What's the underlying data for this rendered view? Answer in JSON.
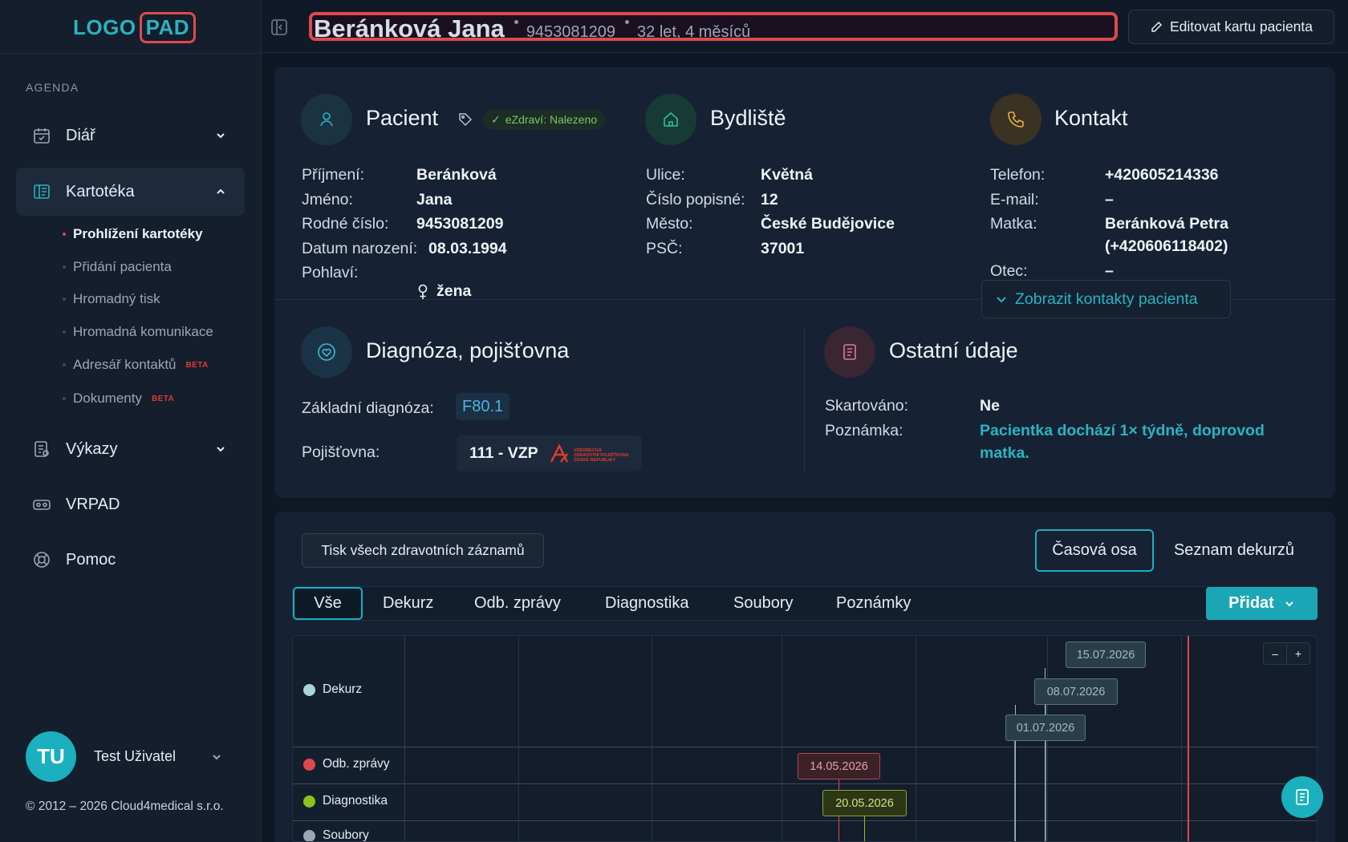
{
  "brand": {
    "logo_part1": "LOGO",
    "logo_part2": "PAD"
  },
  "sidebar": {
    "section_label": "AGENDA",
    "nav": [
      {
        "label": "Diář",
        "icon": "calendar-icon"
      },
      {
        "label": "Kartotéka",
        "icon": "book-icon"
      },
      {
        "label": "Výkazy",
        "icon": "report-icon"
      },
      {
        "label": "VRPAD",
        "icon": "vr-headset-icon"
      },
      {
        "label": "Pomoc",
        "icon": "lifebuoy-icon"
      }
    ],
    "sub_items": [
      {
        "label": "Prohlížení kartotéky",
        "badge": ""
      },
      {
        "label": "Přidání pacienta",
        "badge": ""
      },
      {
        "label": "Hromadný tisk",
        "badge": ""
      },
      {
        "label": "Hromadná komunikace",
        "badge": ""
      },
      {
        "label": "Adresář kontaktů",
        "badge": "BETA"
      },
      {
        "label": "Dokumenty",
        "badge": "BETA"
      }
    ],
    "user": {
      "initials": "TU",
      "name": "Test Uživatel"
    },
    "copyright": "© 2012 – 2026 Cloud4medical s.r.o."
  },
  "header": {
    "patient_name": "Beránková Jana",
    "birth_number": "9453081209",
    "age": "32 let, 4 měsíců",
    "edit_label": "Editovat kartu pacienta"
  },
  "patient": {
    "title": "Pacient",
    "ezdravi": "eZdraví: Nalezeno",
    "fields": [
      {
        "k": "Příjmení:",
        "v": "Beránková"
      },
      {
        "k": "Jméno:",
        "v": "Jana"
      },
      {
        "k": "Rodné číslo:",
        "v": "9453081209"
      },
      {
        "k": "Datum narození:",
        "v": "08.03.1994"
      },
      {
        "k": "Pohlaví:",
        "v": "žena"
      }
    ]
  },
  "address": {
    "title": "Bydliště",
    "fields": [
      {
        "k": "Ulice:",
        "v": "Květná"
      },
      {
        "k": "Číslo popisné:",
        "v": "12"
      },
      {
        "k": "Město:",
        "v": "České Budějovice"
      },
      {
        "k": "PSČ:",
        "v": "37001"
      }
    ]
  },
  "contact": {
    "title": "Kontakt",
    "phone_k": "Telefon:",
    "phone_v": "+420605214336",
    "email_k": "E-mail:",
    "email_v": "–",
    "mother_k": "Matka:",
    "mother_v1": "Beránková Petra",
    "mother_v2": "(+420606118402)",
    "father_k": "Otec:",
    "father_v": "–",
    "show_label": "Zobrazit kontakty pacienta"
  },
  "diagnosis": {
    "title": "Diagnóza, pojišťovna",
    "diag_k": "Základní diagnóza:",
    "diag_v": "F80.1",
    "ins_k": "Pojišťovna:",
    "ins_v": "111 - VZP",
    "ins_logo_text": "VŠEOBECNÁ ZDRAVOTNÍ POJIŠŤOVNA ČESKÉ REPUBLIKY"
  },
  "other": {
    "title": "Ostatní údaje",
    "shred_k": "Skartováno:",
    "shred_v": "Ne",
    "note_k": "Poznámka:",
    "note_v1": "Pacientka dochází 1× týdně, doprovod",
    "note_v2": "matka."
  },
  "records": {
    "print_label": "Tisk všech zdravotních záznamů",
    "view_timeline": "Časová osa",
    "view_list": "Seznam dekurzů",
    "tabs": [
      "Vše",
      "Dekurz",
      "Odb. zprávy",
      "Diagnostika",
      "Soubory",
      "Poznámky"
    ],
    "add_label": "Přidat",
    "zoom_out": "–",
    "zoom_in": "+"
  },
  "timeline": {
    "lanes": [
      {
        "label": "Dekurz",
        "color": "#a8d4dc"
      },
      {
        "label": "Odb. zprávy",
        "color": "#e0494c"
      },
      {
        "label": "Diagnostika",
        "color": "#8dc21f"
      },
      {
        "label": "Soubory",
        "color": "#9aa6b6"
      }
    ],
    "events": [
      {
        "lane": "Dekurz",
        "date": "15.07.2026"
      },
      {
        "lane": "Dekurz",
        "date": "08.07.2026"
      },
      {
        "lane": "Dekurz",
        "date": "01.07.2026"
      },
      {
        "lane": "Odb. zprávy",
        "date": "14.05.2026"
      },
      {
        "lane": "Diagnostika",
        "date": "20.05.2026"
      }
    ]
  }
}
